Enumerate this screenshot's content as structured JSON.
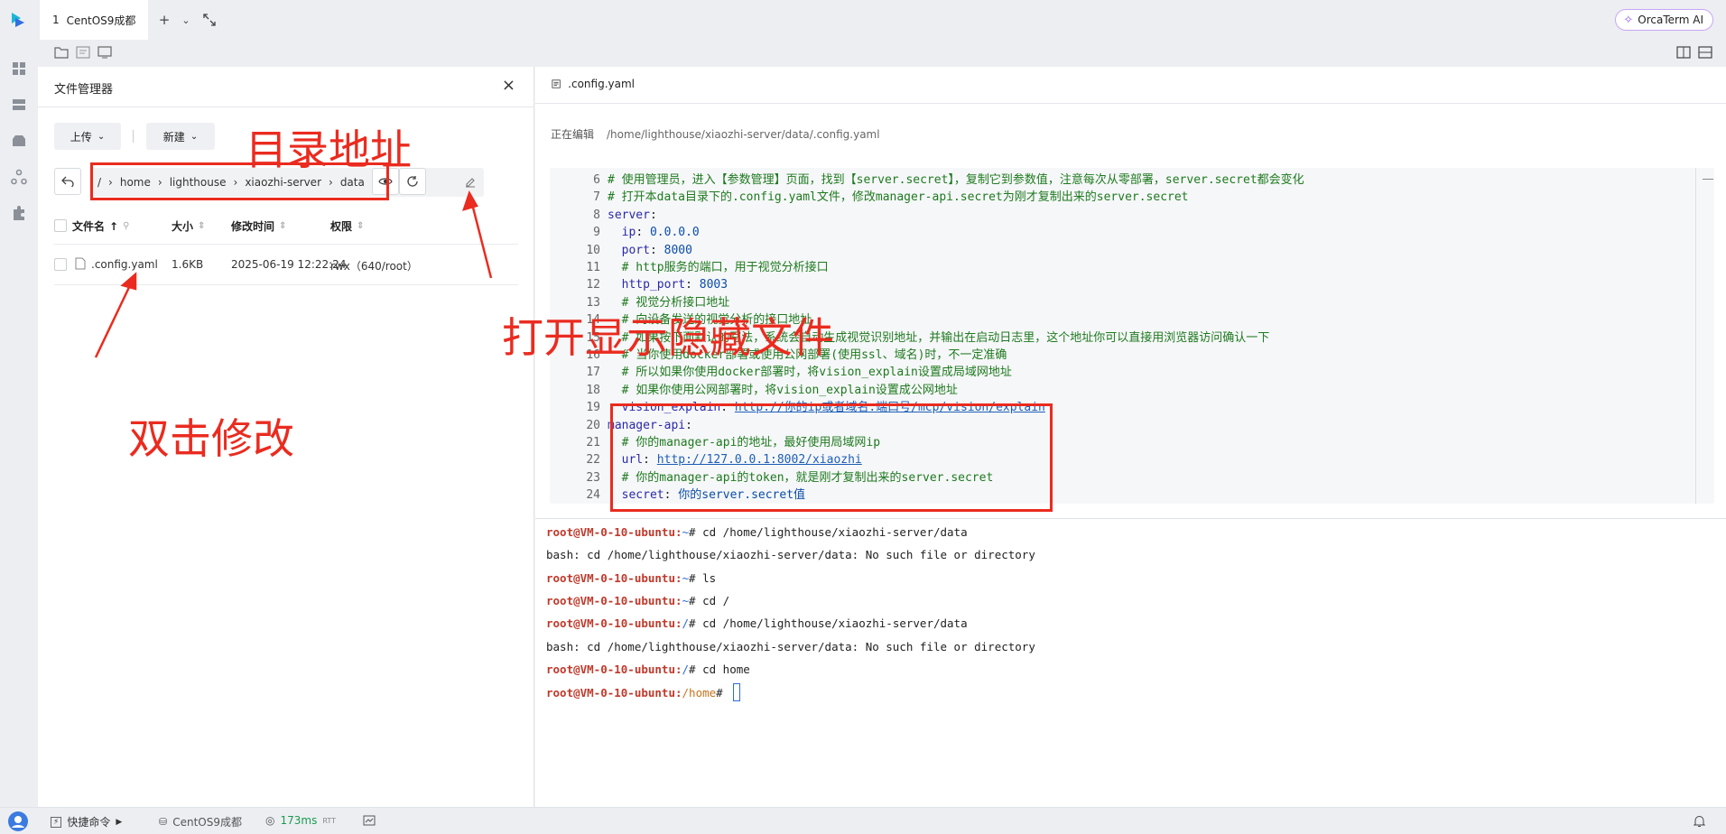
{
  "topbar": {
    "tab_number": "1",
    "tab_title": "CentOS9成都",
    "orca_label": "OrcaTerm AI"
  },
  "file_manager": {
    "title": "文件管理器",
    "upload_label": "上传",
    "new_label": "新建",
    "path_segments": [
      "/",
      "home",
      "lighthouse",
      "xiaozhi-server",
      "data"
    ],
    "columns": {
      "name": "文件名",
      "size": "大小",
      "modified": "修改时间",
      "permission": "权限"
    },
    "rows": [
      {
        "name": ".config.yaml",
        "size": "1.6KB",
        "modified": "2025-06-19 12:22:24",
        "permission": "rwx（640/root）"
      }
    ]
  },
  "editor": {
    "tab_label": ".config.yaml",
    "status_label": "正在编辑",
    "status_path": "/home/lighthouse/xiaozhi-server/data/.config.yaml",
    "lines": [
      {
        "n": "6",
        "t": "# 使用管理员，进入【参数管理】页面，找到【server.secret】，复制它到参数值，注意每次从零部署，server.secret都会变化"
      },
      {
        "n": "7",
        "t": "# 打开本data目录下的.config.yaml文件，修改manager-api.secret为刚才复制出来的server.secret"
      },
      {
        "n": "8",
        "t": "server:"
      },
      {
        "n": "9",
        "t": "  ip: 0.0.0.0"
      },
      {
        "n": "10",
        "t": "  port: 8000"
      },
      {
        "n": "11",
        "t": "  # http服务的端口，用于视觉分析接口"
      },
      {
        "n": "12",
        "t": "  http_port: 8003"
      },
      {
        "n": "13",
        "t": "  # 视觉分析接口地址"
      },
      {
        "n": "14",
        "t": "  # 向设备发送的视觉分析的接口地址"
      },
      {
        "n": "15",
        "t": "  # 如果按下面默认的写法，系统会自动生成视觉识别地址，并输出在启动日志里，这个地址你可以直接用浏览器访问确认一下"
      },
      {
        "n": "16",
        "t": "  # 当你使用docker部署或使用公网部署(使用ssl、域名)时，不一定准确"
      },
      {
        "n": "17",
        "t": "  # 所以如果你使用docker部署时，将vision_explain设置成局域网地址"
      },
      {
        "n": "18",
        "t": "  # 如果你使用公网部署时，将vision_explain设置成公网地址"
      },
      {
        "n": "19",
        "t": "  vision_explain: http://你的ip或者域名:端口号/mcp/vision/explain"
      },
      {
        "n": "20",
        "t": "manager-api:"
      },
      {
        "n": "21",
        "t": "  # 你的manager-api的地址，最好使用局域网ip"
      },
      {
        "n": "22",
        "t": "  url: http://127.0.0.1:8002/xiaozhi"
      },
      {
        "n": "23",
        "t": "  # 你的manager-api的token，就是刚才复制出来的server.secret"
      },
      {
        "n": "24",
        "t": "  secret: 你的server.secret值"
      }
    ]
  },
  "terminal": {
    "lines": [
      {
        "user": "root@VM-0-10-ubuntu",
        "path": "~",
        "cmd": "cd /home/lighthouse/xiaozhi-server/data"
      },
      {
        "out": "bash: cd /home/lighthouse/xiaozhi-server/data: No such file or directory"
      },
      {
        "user": "root@VM-0-10-ubuntu",
        "path": "~",
        "cmd": "ls"
      },
      {
        "user": "root@VM-0-10-ubuntu",
        "path": "~",
        "cmd": "cd /"
      },
      {
        "user": "root@VM-0-10-ubuntu",
        "path": "/",
        "cmd": "cd /home/lighthouse/xiaozhi-server/data"
      },
      {
        "out": "bash: cd /home/lighthouse/xiaozhi-server/data: No such file or directory"
      },
      {
        "user": "root@VM-0-10-ubuntu",
        "path": "/",
        "cmd": "cd home"
      },
      {
        "user": "root@VM-0-10-ubuntu",
        "path": "/home",
        "cmd": ""
      }
    ]
  },
  "bottombar": {
    "quick_cmd": "快捷命令",
    "host": "CentOS9成都",
    "latency": "173ms",
    "latency_unit": "RTT"
  },
  "annotations": {
    "dir_address": "目录地址",
    "show_hidden": "打开显示隐藏文件",
    "double_click": "双击修改"
  },
  "colors": {
    "annotation_red": "#ea2b1f",
    "prompt_red": "#c0392b",
    "link_blue": "#1d5fb6"
  }
}
